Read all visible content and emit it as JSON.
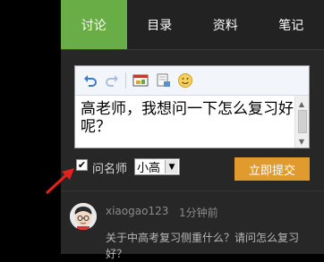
{
  "tabs": [
    {
      "label": "讨论",
      "active": true
    },
    {
      "label": "目录",
      "active": false
    },
    {
      "label": "资料",
      "active": false
    },
    {
      "label": "笔记",
      "active": false
    }
  ],
  "editor": {
    "toolbar_icons": [
      "undo-icon",
      "redo-icon",
      "image-icon",
      "attachment-icon",
      "emoji-icon"
    ],
    "content": "高老师，我想问一下怎么复习好呢？"
  },
  "ask_teacher": {
    "label": "问名师",
    "checked": true,
    "selected_teacher": "小高"
  },
  "submit_label": "立即提交",
  "comment": {
    "username": "xiaogao123",
    "timestamp": "1分钟前",
    "text": "关于中高考复习侧重什么？请问怎么复习好？"
  },
  "colors": {
    "active_tab": "#69ad47",
    "submit": "#e09a2e",
    "panel": "#272727"
  }
}
